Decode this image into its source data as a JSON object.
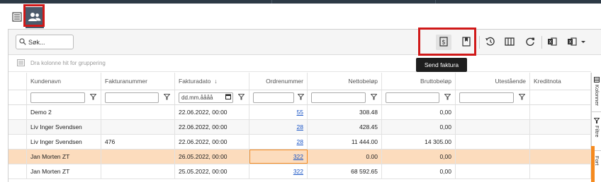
{
  "view_switch": {
    "list_icon": "list-icon",
    "customers_icon": "users-icon"
  },
  "toolbar": {
    "search_placeholder": "Søk...",
    "send_invoice_icon": "invoice-dollar-icon",
    "bookmark_icon": "bookmark-icon",
    "history_icon": "history-icon",
    "columns_icon": "columns-icon",
    "refresh_icon": "refresh-icon",
    "excel_icon": "excel-icon",
    "excel_dropdown_icon": "excel-dropdown-icon"
  },
  "tooltip": "Send faktura",
  "group_hint": "Dra kolonne hit for gruppering",
  "columns": [
    "Kundenavn",
    "Fakturanummer",
    "Fakturadato",
    "Ordrenummer",
    "Nettobeløp",
    "Bruttobeløp",
    "Utestående",
    "Kreditnota"
  ],
  "sort_indicator": "↓",
  "date_filter_placeholder": "dd.mm.åååå",
  "rows": [
    {
      "kundenavn": "Demo 2",
      "fakturanummer": "",
      "fakturadato": "22.06.2022, 00:00",
      "ordrenummer": "55",
      "netto": "308.48",
      "brutto": "0,00",
      "utestaende": "",
      "kreditnota": ""
    },
    {
      "kundenavn": "Liv Inger Svendsen",
      "fakturanummer": "",
      "fakturadato": "22.06.2022, 00:00",
      "ordrenummer": "28",
      "netto": "428.45",
      "brutto": "0,00",
      "utestaende": "",
      "kreditnota": ""
    },
    {
      "kundenavn": "Liv Inger Svendsen",
      "fakturanummer": "476",
      "fakturadato": "22.06.2022, 00:00",
      "ordrenummer": "28",
      "netto": "11 444.00",
      "brutto": "14 305.00",
      "utestaende": "",
      "kreditnota": ""
    },
    {
      "kundenavn": "Jan Morten ZT",
      "fakturanummer": "",
      "fakturadato": "26.05.2022, 00:00",
      "ordrenummer": "322",
      "netto": "0.00",
      "brutto": "0,00",
      "utestaende": "",
      "kreditnota": "",
      "selected": true
    },
    {
      "kundenavn": "Jan Morten ZT",
      "fakturanummer": "",
      "fakturadato": "25.05.2022, 00:00",
      "ordrenummer": "322",
      "netto": "68 592.65",
      "brutto": "0,00",
      "utestaende": "",
      "kreditnota": ""
    }
  ],
  "side_tabs": [
    "Kolonner",
    "Filtre",
    "Fort"
  ],
  "colors": {
    "accent": "#f58a1f",
    "selected_row": "#fcdcbd",
    "highlight_box": "#d01919",
    "link": "#1a55c6"
  }
}
